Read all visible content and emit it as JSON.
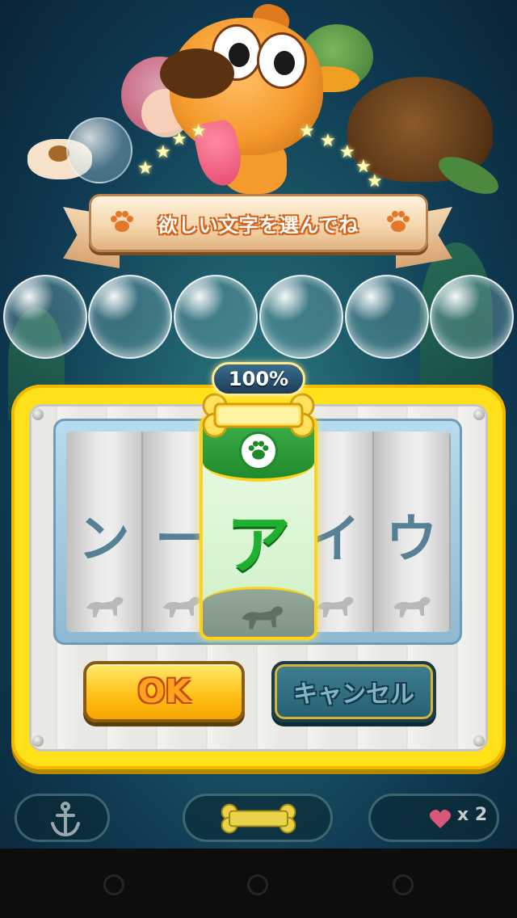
{
  "banner": {
    "text": "欲しい文字を選んでね"
  },
  "badge": {
    "percent": "100%"
  },
  "bubble_slots": 6,
  "reels": [
    {
      "char": "ン"
    },
    {
      "char": "ー"
    },
    {
      "char": "ア",
      "selected": true
    },
    {
      "char": "イ"
    },
    {
      "char": "ウ"
    }
  ],
  "buttons": {
    "ok_label": "OK",
    "cancel_label": "キャンセル"
  },
  "bottom_bar": {
    "lives_count": "x 2"
  },
  "colors": {
    "frame": "#ffe11a",
    "selected": "#1fb02f",
    "accent": "#d4621a"
  },
  "icons": [
    "paw-icon",
    "bone-icon",
    "anchor-icon",
    "heart-icon",
    "dog-silhouette-icon"
  ]
}
